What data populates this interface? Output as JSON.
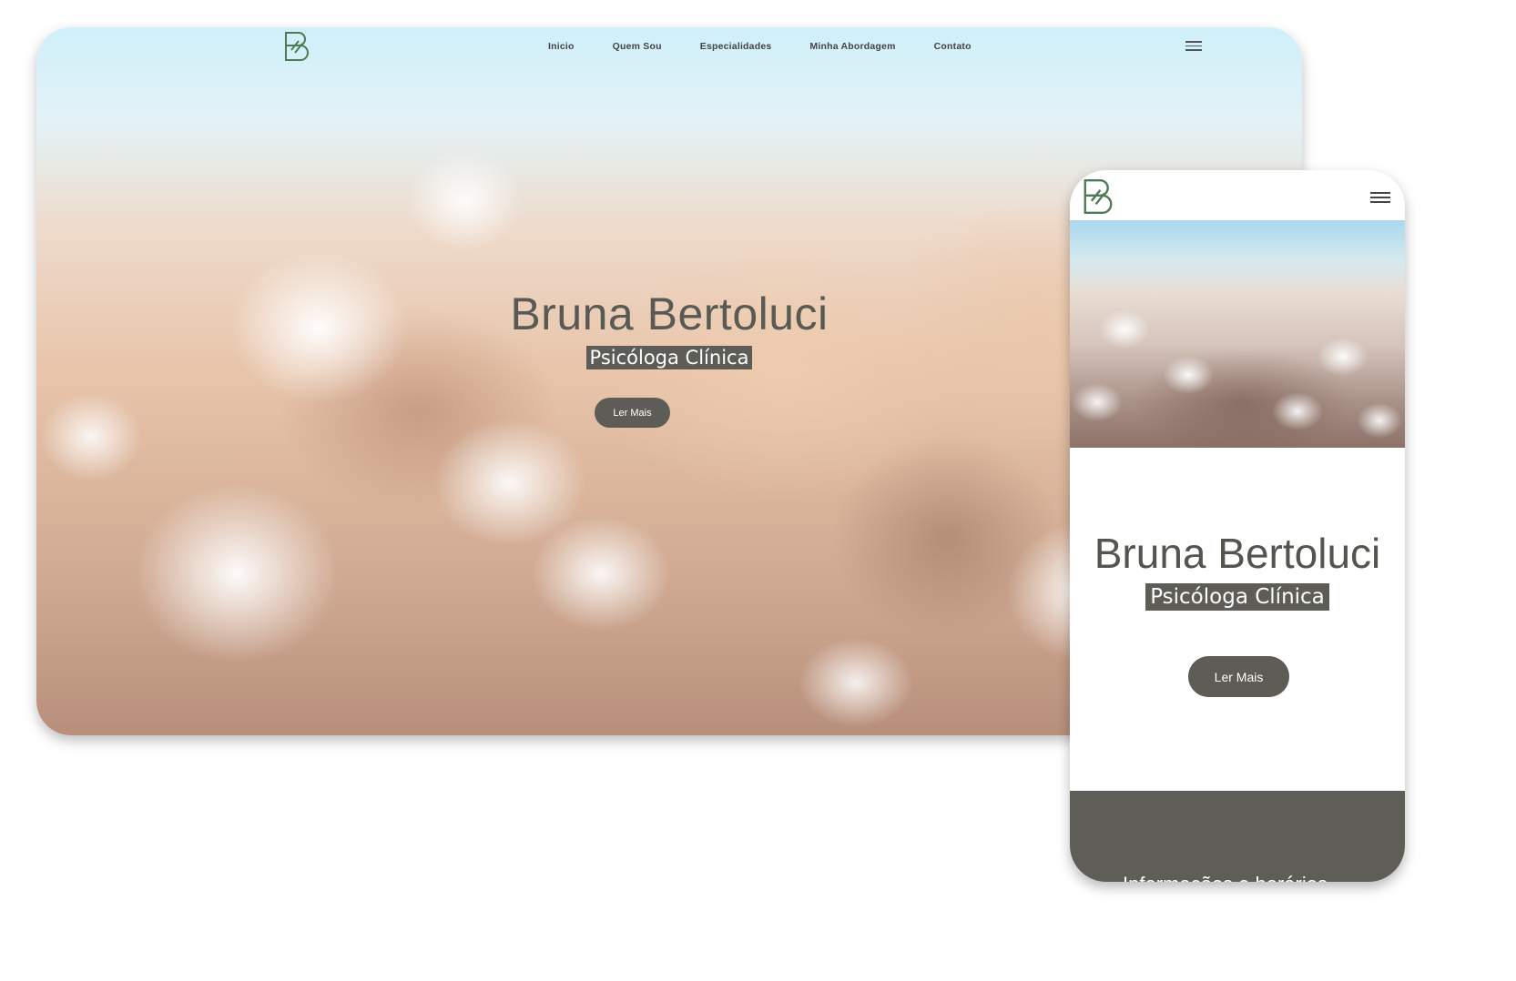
{
  "colors": {
    "brand_green": "#4c7a52",
    "button_bg": "#5d5c56",
    "footer_bg": "#5e5d57",
    "heading_text": "#5a5a55",
    "sky": "#cfeff9"
  },
  "desktop": {
    "logo_icon": "b-monogram-logo",
    "nav": {
      "items": [
        "Inicio",
        "Quem Sou",
        "Especialidades",
        "Minha Abordagem",
        "Contato"
      ],
      "menu_icon": "hamburger-menu-icon"
    },
    "hero": {
      "background": "cotton-field-photo",
      "name": "Bruna Bertoluci",
      "subtitle": "Psicóloga Clínica",
      "button_label": "Ler Mais"
    }
  },
  "mobile": {
    "logo_icon": "b-monogram-logo",
    "menu_icon": "hamburger-menu-icon",
    "hero_image": "cotton-field-photo",
    "name": "Bruna Bertoluci",
    "subtitle": "Psicóloga Clínica",
    "button_label": "Ler Mais",
    "footer_text": "Informações e horários"
  }
}
